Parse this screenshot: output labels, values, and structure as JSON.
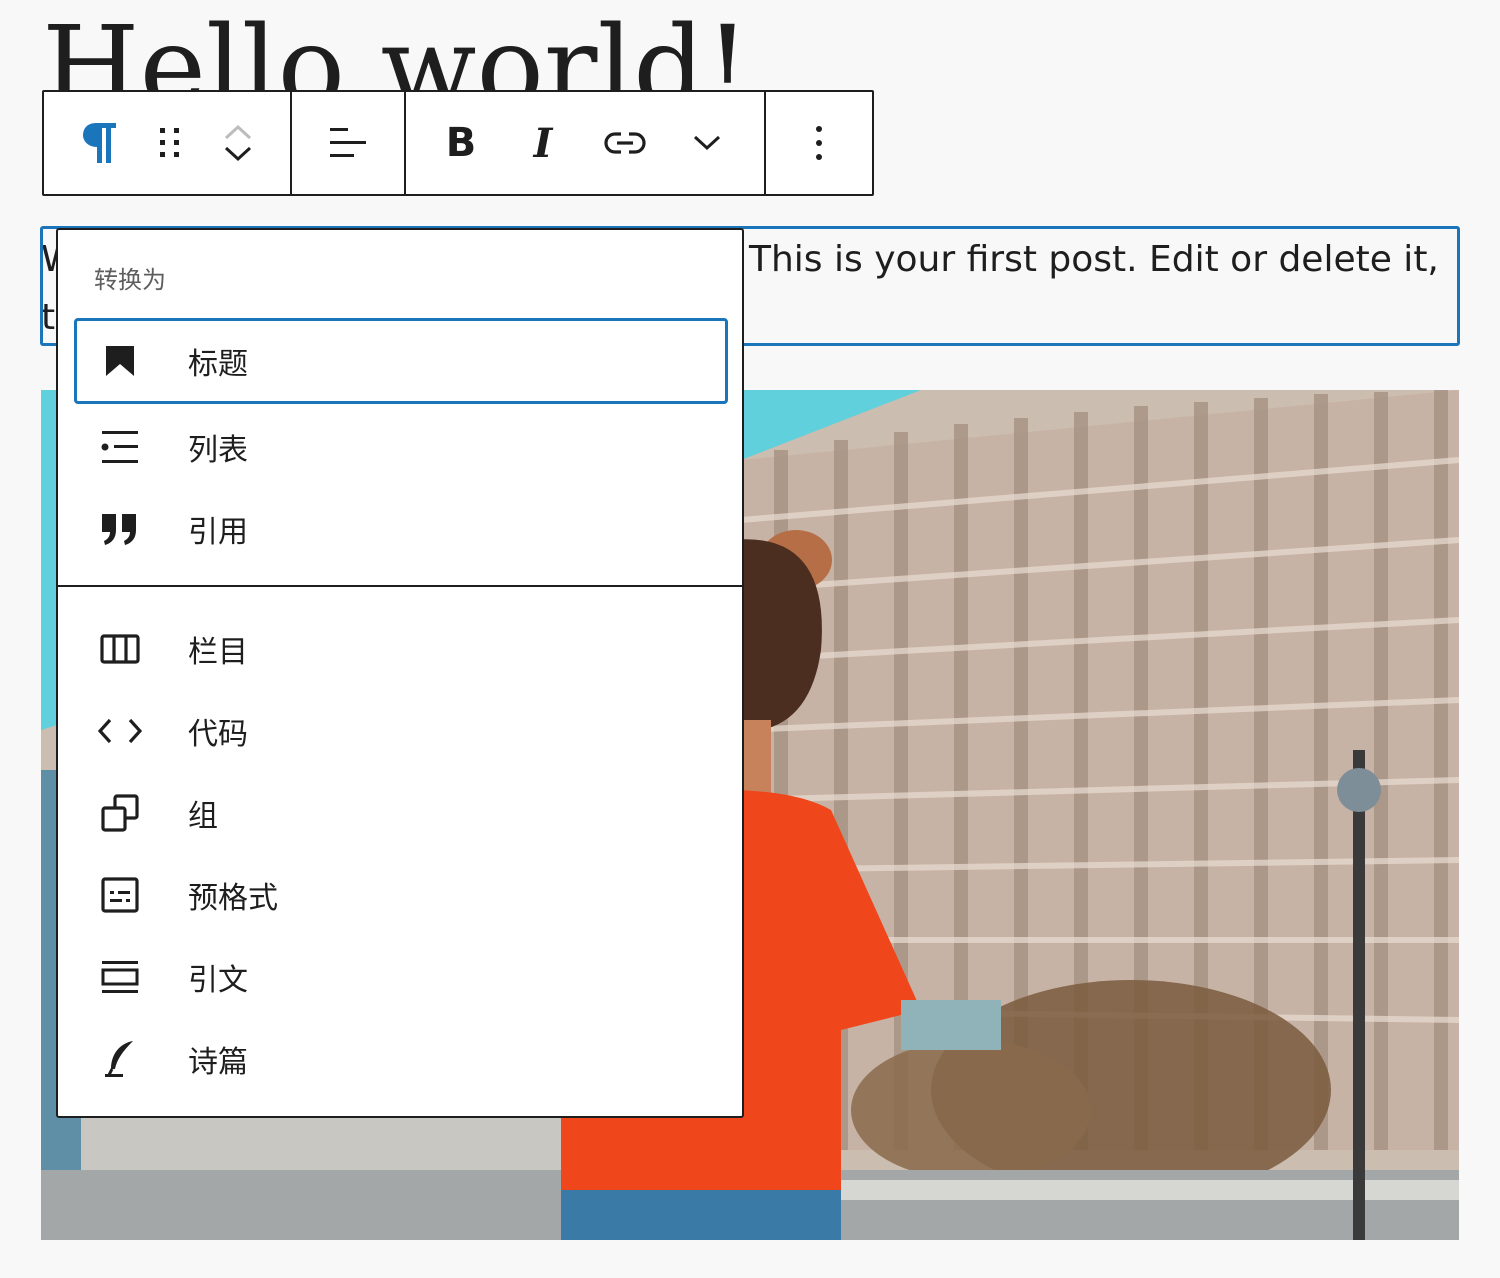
{
  "post": {
    "title": "Hello world!",
    "paragraph_visible": "This is your first post. Edit or delete it,",
    "paragraph_stub_line1": "W",
    "paragraph_stub_line2": "t"
  },
  "toolbar": {
    "block_type_icon": "paragraph-icon",
    "drag_icon": "drag-handle-icon",
    "move_up_icon": "chevron-up-icon",
    "move_down_icon": "chevron-down-icon",
    "align_icon": "align-left-icon",
    "bold_label": "B",
    "italic_label": "I",
    "link_icon": "link-icon",
    "more_rich_text_icon": "chevron-down-icon",
    "options_icon": "more-vertical-icon"
  },
  "transform_menu": {
    "header": "转换为",
    "group1": [
      {
        "label": "标题",
        "icon": "heading-icon",
        "selected": true
      },
      {
        "label": "列表",
        "icon": "list-icon",
        "selected": false
      },
      {
        "label": "引用",
        "icon": "quote-icon",
        "selected": false
      }
    ],
    "group2": [
      {
        "label": "栏目",
        "icon": "columns-icon"
      },
      {
        "label": "代码",
        "icon": "code-icon"
      },
      {
        "label": "组",
        "icon": "group-icon"
      },
      {
        "label": "预格式",
        "icon": "preformatted-icon"
      },
      {
        "label": "引文",
        "icon": "pullquote-icon"
      },
      {
        "label": "诗篇",
        "icon": "verse-icon"
      }
    ]
  },
  "colors": {
    "accent": "#1a75bb",
    "border": "#1e1e1e",
    "background": "#f8f8f8",
    "muted_text": "#5e5e5e"
  }
}
